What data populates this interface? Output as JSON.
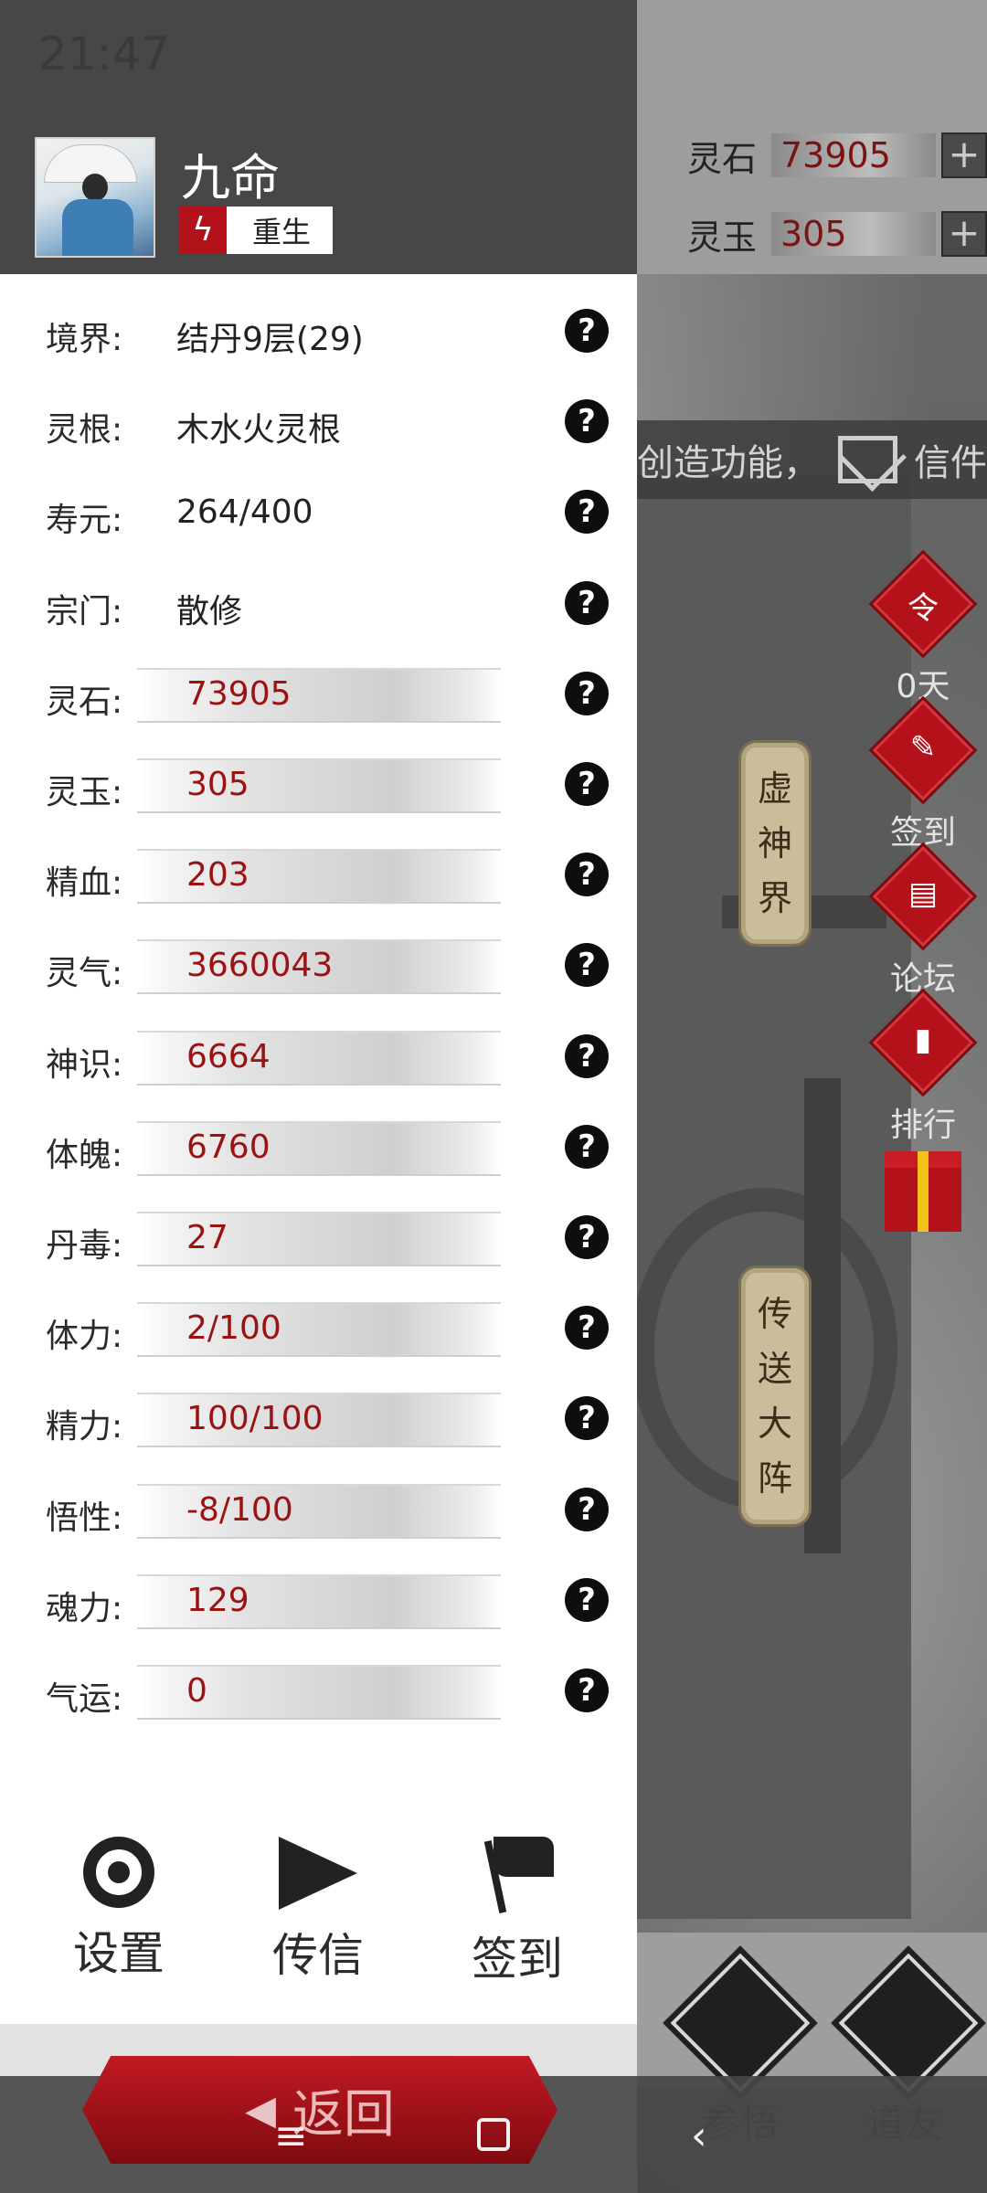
{
  "status_bar": {
    "time": "21:47"
  },
  "player": {
    "name": "九命",
    "badge_icon": "lightning-icon",
    "badge_label": "重生"
  },
  "stats": [
    {
      "label": "境界:",
      "value": "结丹9层(29)",
      "style": "plain"
    },
    {
      "label": "灵根:",
      "value": "木水火灵根",
      "style": "plain"
    },
    {
      "label": "寿元:",
      "value": "264/400",
      "style": "plain"
    },
    {
      "label": "宗门:",
      "value": "散修",
      "style": "plain"
    },
    {
      "label": "灵石:",
      "value": "73905",
      "style": "bar"
    },
    {
      "label": "灵玉:",
      "value": "305",
      "style": "bar"
    },
    {
      "label": "精血:",
      "value": "203",
      "style": "bar"
    },
    {
      "label": "灵气:",
      "value": "3660043",
      "style": "bar"
    },
    {
      "label": "神识:",
      "value": "6664",
      "style": "bar"
    },
    {
      "label": "体魄:",
      "value": "6760",
      "style": "bar"
    },
    {
      "label": "丹毒:",
      "value": "27",
      "style": "bar"
    },
    {
      "label": "体力:",
      "value": "2/100",
      "style": "bar"
    },
    {
      "label": "精力:",
      "value": "100/100",
      "style": "bar"
    },
    {
      "label": "悟性:",
      "value": "-8/100",
      "style": "bar"
    },
    {
      "label": "魂力:",
      "value": "129",
      "style": "bar"
    },
    {
      "label": "气运:",
      "value": "0",
      "style": "bar"
    }
  ],
  "actions": {
    "settings": "设置",
    "message": "传信",
    "checkin": "签到"
  },
  "return_button": "返回",
  "background": {
    "resources": {
      "spirit_stone_label": "灵石",
      "spirit_stone_value": "73905",
      "spirit_jade_label": "灵玉",
      "spirit_jade_value": "305",
      "plus": "+"
    },
    "notice": {
      "text": "创造功能，",
      "mail_label": "信件"
    },
    "places": {
      "void_realm": [
        "虚",
        "神",
        "界"
      ],
      "teleport": [
        "传",
        "送",
        "大",
        "阵"
      ]
    },
    "side_buttons": {
      "order_glyph": "令",
      "days": "0天",
      "checkin": "签到",
      "forum": "论坛",
      "ranking": "排行"
    },
    "bottom_tabs": {
      "enlighten": "参悟",
      "friends": "道友"
    }
  },
  "colors": {
    "accent_red": "#b3121a",
    "value_red": "#9b1212",
    "drawer_header": "#474747"
  }
}
